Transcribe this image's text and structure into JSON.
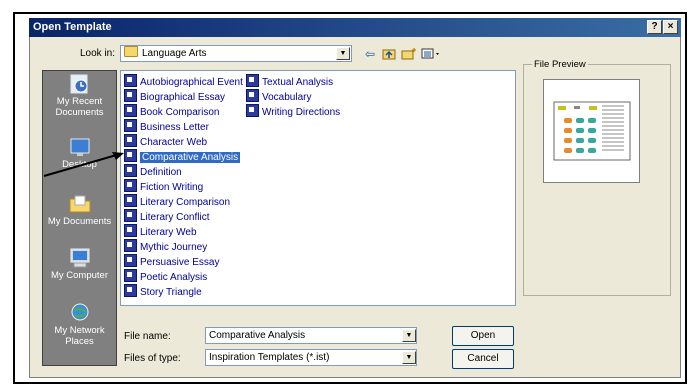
{
  "window": {
    "title": "Open Template",
    "help_button": "?",
    "close_button": "×"
  },
  "look_in": {
    "label": "Look in:",
    "value": "Language Arts"
  },
  "places": [
    {
      "label": "My Recent Documents",
      "icon": "recent-documents-icon"
    },
    {
      "label": "Desktop",
      "icon": "desktop-icon"
    },
    {
      "label": "My Documents",
      "icon": "my-documents-icon"
    },
    {
      "label": "My Computer",
      "icon": "my-computer-icon"
    },
    {
      "label": "My Network Places",
      "icon": "my-network-places-icon"
    }
  ],
  "files": {
    "column1": [
      "Autobiographical Event",
      "Biographical Essay",
      "Book Comparison",
      "Business Letter",
      "Character Web",
      "Comparative Analysis",
      "Definition",
      "Fiction Writing",
      "Literary Comparison",
      "Literary Conflict",
      "Literary Web",
      "Mythic Journey",
      "Persuasive Essay",
      "Poetic Analysis",
      "Story Triangle"
    ],
    "column2": [
      "Textual Analysis",
      "Vocabulary",
      "Writing Directions"
    ],
    "selected": "Comparative Analysis"
  },
  "file_name": {
    "label": "File name:",
    "value": "Comparative Analysis"
  },
  "file_type": {
    "label": "Files of type:",
    "value": "Inspiration Templates (*.ist)"
  },
  "buttons": {
    "open": "Open",
    "cancel": "Cancel"
  },
  "preview": {
    "label": "File Preview"
  },
  "colors": {
    "title_start": "#0a246a",
    "title_end": "#3a6ea5",
    "selection": "#316ac5",
    "dialog_bg": "#ece9d8"
  }
}
